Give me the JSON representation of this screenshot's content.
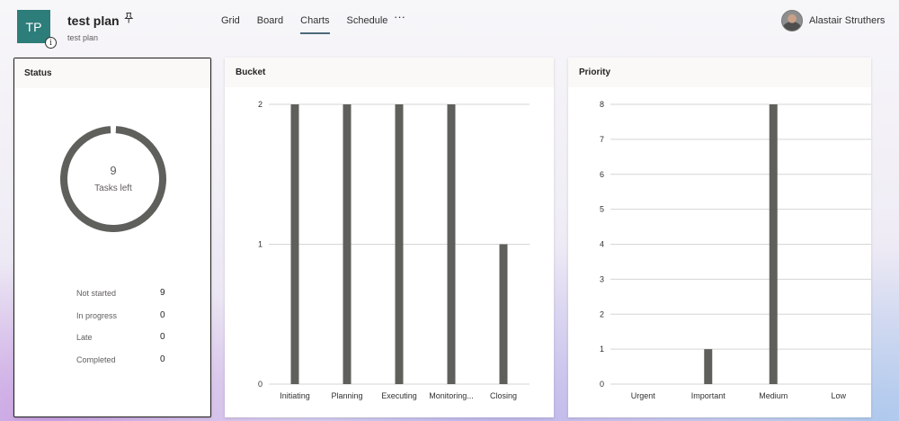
{
  "header": {
    "plan_initials": "TP",
    "plan_title": "test plan",
    "plan_subtitle": "test plan",
    "tabs": [
      {
        "label": "Grid"
      },
      {
        "label": "Board"
      },
      {
        "label": "Charts",
        "active": true
      },
      {
        "label": "Schedule"
      }
    ],
    "more": "···",
    "user_name": "Alastair Struthers",
    "info_glyph": "i",
    "icons": [
      "pin-icon",
      "info-icon",
      "more-icon",
      "avatar"
    ]
  },
  "status": {
    "title": "Status",
    "tasks_left_count": "9",
    "tasks_left_label": "Tasks left",
    "rows": [
      {
        "label": "Not started",
        "value": "9"
      },
      {
        "label": "In progress",
        "value": "0"
      },
      {
        "label": "Late",
        "value": "0"
      },
      {
        "label": "Completed",
        "value": "0"
      }
    ],
    "donut_color": "#5f5f5c"
  },
  "bucket": {
    "title": "Bucket",
    "chart_data": {
      "type": "bar",
      "categories": [
        "Initiating",
        "Planning",
        "Executing",
        "Monitoring...",
        "Closing"
      ],
      "values": [
        2,
        2,
        2,
        2,
        1
      ],
      "y_ticks": [
        0,
        1,
        2
      ],
      "ylim": [
        0,
        2
      ],
      "grid": true,
      "bar_color": "#5f5f5c"
    }
  },
  "priority": {
    "title": "Priority",
    "chart_data": {
      "type": "bar",
      "categories": [
        "Urgent",
        "Important",
        "Medium",
        "Low"
      ],
      "values": [
        0,
        1,
        8,
        0
      ],
      "y_ticks": [
        0,
        1,
        2,
        3,
        4,
        5,
        6,
        7,
        8
      ],
      "ylim": [
        0,
        8
      ],
      "grid": true,
      "bar_color": "#5f5f5c"
    }
  }
}
